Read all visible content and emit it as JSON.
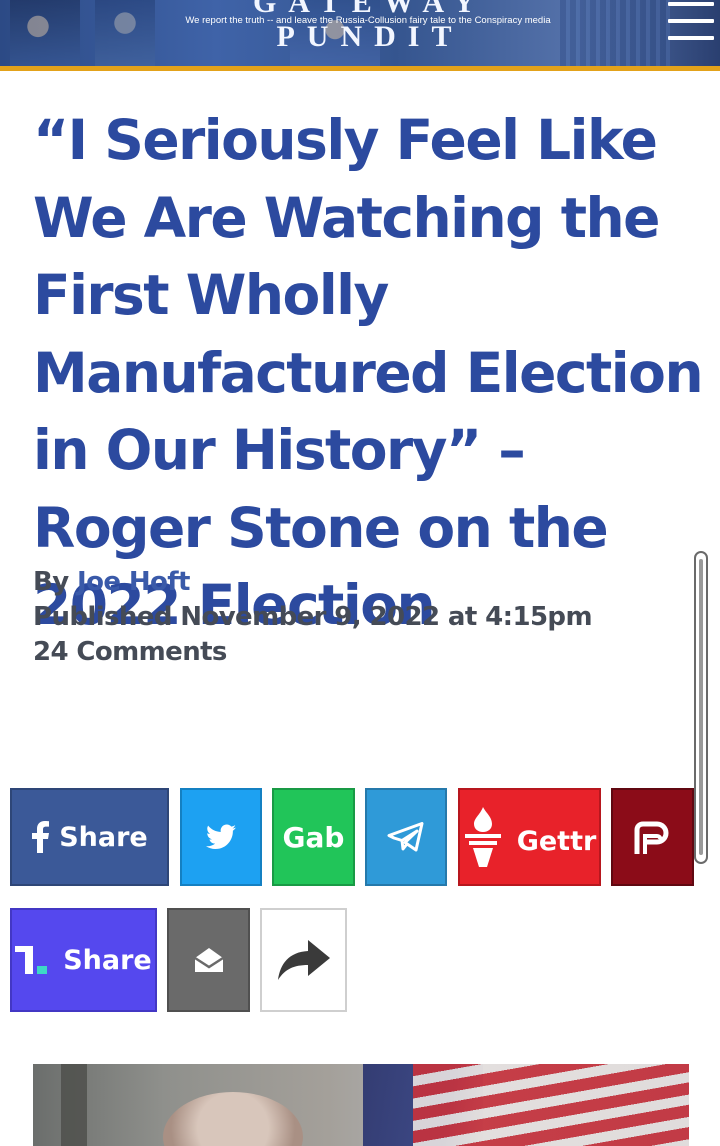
{
  "banner": {
    "title": "GATEWAY PUNDIT",
    "tagline": "We report the truth -- and leave the Russia-Collusion fairy tale to the Conspiracy media",
    "menu_icon": "hamburger-menu-icon",
    "colors": {
      "banner_blue": "#3f63a8",
      "rule_gold": "#e3a21a"
    }
  },
  "article": {
    "headline": "“I Seriously Feel Like We Are Watching the First Wholly Manufactured Election in Our History” – Roger Stone on the 2022 Election",
    "by_prefix": "By",
    "author": "Joe Hoft",
    "published": "Published November 9, 2022 at 4:15pm",
    "comments": "24 Comments",
    "colors": {
      "headline": "#2c4a9f",
      "meta": "#454b56",
      "author_link": "#3a5aa9"
    }
  },
  "share": {
    "facebook": {
      "label": "Share",
      "icon": "facebook-icon",
      "color": "#3b5998"
    },
    "twitter": {
      "icon": "twitter-icon",
      "color": "#1da1f2"
    },
    "gab": {
      "label": "Gab",
      "color": "#21c559"
    },
    "telegram": {
      "icon": "telegram-icon",
      "color": "#2f9ad8"
    },
    "gettr": {
      "label": "Gettr",
      "icon": "gettr-torch-icon",
      "color": "#e8222a"
    },
    "parler": {
      "icon": "parler-icon",
      "color": "#8b0c18"
    },
    "truth": {
      "label": "Share",
      "icon": "truth-social-icon",
      "color": "#5548ee"
    },
    "email": {
      "icon": "envelope-icon",
      "color": "#6a6a6a"
    },
    "more": {
      "icon": "share-arrow-icon"
    }
  },
  "hero_image": {
    "alt": "Roger Stone in front of an American flag"
  }
}
